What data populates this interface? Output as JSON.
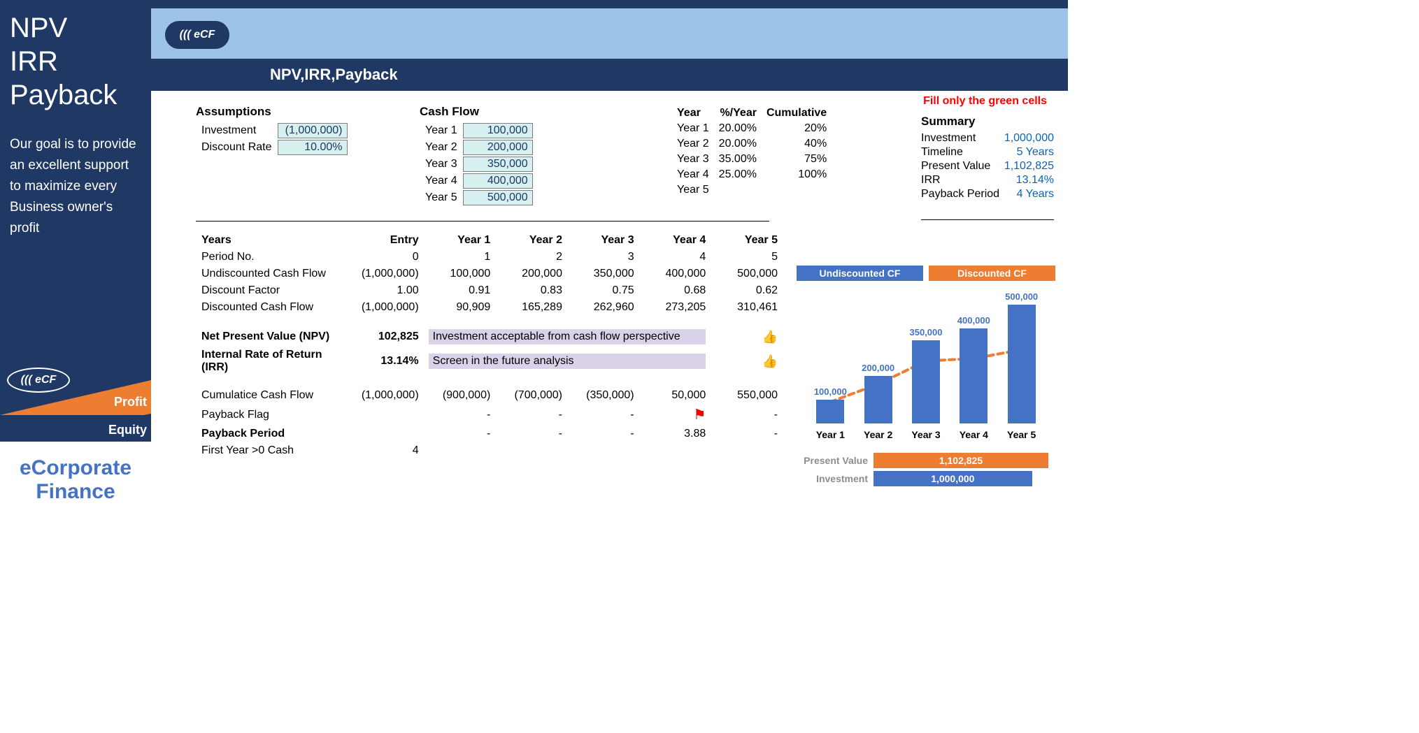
{
  "sidebar": {
    "title_line1": "NPV",
    "title_line2": "IRR",
    "title_line3": "Payback",
    "sub": "Our goal is to provide an excellent support to maximize every Business owner's profit",
    "ecf": "((( eCF",
    "profit": "Profit",
    "equity": "Equity",
    "brand1": "eCorporate",
    "brand2": "Finance"
  },
  "header": {
    "ecf": "((( eCF",
    "nav": "NPV,IRR,Payback"
  },
  "note": "Fill only the green cells",
  "assumptions": {
    "title": "Assumptions",
    "rows": [
      {
        "label": "Investment",
        "value": "(1,000,000)"
      },
      {
        "label": "Discount Rate",
        "value": "10.00%"
      }
    ]
  },
  "cashflow": {
    "title": "Cash Flow",
    "rows": [
      {
        "label": "Year 1",
        "value": "100,000"
      },
      {
        "label": "Year 2",
        "value": "200,000"
      },
      {
        "label": "Year 3",
        "value": "350,000"
      },
      {
        "label": "Year 4",
        "value": "400,000"
      },
      {
        "label": "Year 5",
        "value": "500,000"
      }
    ]
  },
  "pct": {
    "h_year": "Year",
    "h_pct": "%/Year",
    "h_cum": "Cumulative",
    "rows": [
      {
        "y": "Year 1",
        "p": "20.00%",
        "c": "20%"
      },
      {
        "y": "Year 2",
        "p": "20.00%",
        "c": "40%"
      },
      {
        "y": "Year 3",
        "p": "35.00%",
        "c": "75%"
      },
      {
        "y": "Year 4",
        "p": "25.00%",
        "c": "100%"
      },
      {
        "y": "Year 5",
        "p": "",
        "c": ""
      }
    ]
  },
  "summary": {
    "title": "Summary",
    "rows": [
      {
        "l": "Investment",
        "v": "1,000,000"
      },
      {
        "l": "Timeline",
        "v": "5 Years"
      },
      {
        "l": "Present Value",
        "v": "1,102,825"
      },
      {
        "l": "IRR",
        "v": "13.14%"
      },
      {
        "l": "Payback Period",
        "v": "4 Years"
      }
    ]
  },
  "analysis": {
    "headers": {
      "years": "Years",
      "entry": "Entry",
      "y1": "Year 1",
      "y2": "Year 2",
      "y3": "Year 3",
      "y4": "Year 4",
      "y5": "Year 5"
    },
    "period": {
      "l": "Period No.",
      "v": [
        "0",
        "1",
        "2",
        "3",
        "4",
        "5"
      ]
    },
    "undisc": {
      "l": "Undiscounted Cash Flow",
      "v": [
        "(1,000,000)",
        "100,000",
        "200,000",
        "350,000",
        "400,000",
        "500,000"
      ]
    },
    "dfac": {
      "l": "Discount Factor",
      "v": [
        "1.00",
        "0.91",
        "0.83",
        "0.75",
        "0.68",
        "0.62"
      ]
    },
    "dcf": {
      "l": "Discounted Cash Flow",
      "v": [
        "(1,000,000)",
        "90,909",
        "165,289",
        "262,960",
        "273,205",
        "310,461"
      ]
    },
    "npv": {
      "l": "Net Present Value (NPV)",
      "v": "102,825",
      "note": "Investment acceptable from cash flow perspective"
    },
    "irr": {
      "l": "Internal Rate of Return (IRR)",
      "v": "13.14%",
      "note": "Screen in the future analysis"
    },
    "cum": {
      "l": "Cumulatice Cash Flow",
      "v": [
        "(1,000,000)",
        "(900,000)",
        "(700,000)",
        "(350,000)",
        "50,000",
        "550,000"
      ]
    },
    "pflag": {
      "l": "Payback Flag",
      "v": [
        "",
        "-",
        "-",
        "-",
        "flag",
        "-"
      ]
    },
    "pperiod": {
      "l": "Payback Period",
      "v": [
        "",
        "-",
        "-",
        "-",
        "3.88",
        "-"
      ]
    },
    "firstpos": {
      "l": "First Year >0 Cash",
      "v": "4"
    },
    "thumbs": "👍"
  },
  "chart_data": {
    "type": "bar",
    "categories": [
      "Year 1",
      "Year 2",
      "Year 3",
      "Year 4",
      "Year 5"
    ],
    "series": [
      {
        "name": "Undiscounted CF",
        "values": [
          100000,
          200000,
          350000,
          400000,
          500000
        ],
        "labels": [
          "100,000",
          "200,000",
          "350,000",
          "400,000",
          "500,000"
        ]
      },
      {
        "name": "Discounted CF",
        "values": [
          90909,
          165289,
          262960,
          273205,
          310461
        ]
      }
    ],
    "title": "",
    "xlabel": "",
    "ylabel": "",
    "ylim": [
      0,
      500000
    ],
    "legend": [
      "Undiscounted CF",
      "Discounted CF"
    ],
    "kpi": [
      {
        "label": "Present Value",
        "value": 1102825,
        "text": "1,102,825",
        "color": "orange"
      },
      {
        "label": "Investment",
        "value": 1000000,
        "text": "1,000,000",
        "color": "blue"
      }
    ]
  }
}
